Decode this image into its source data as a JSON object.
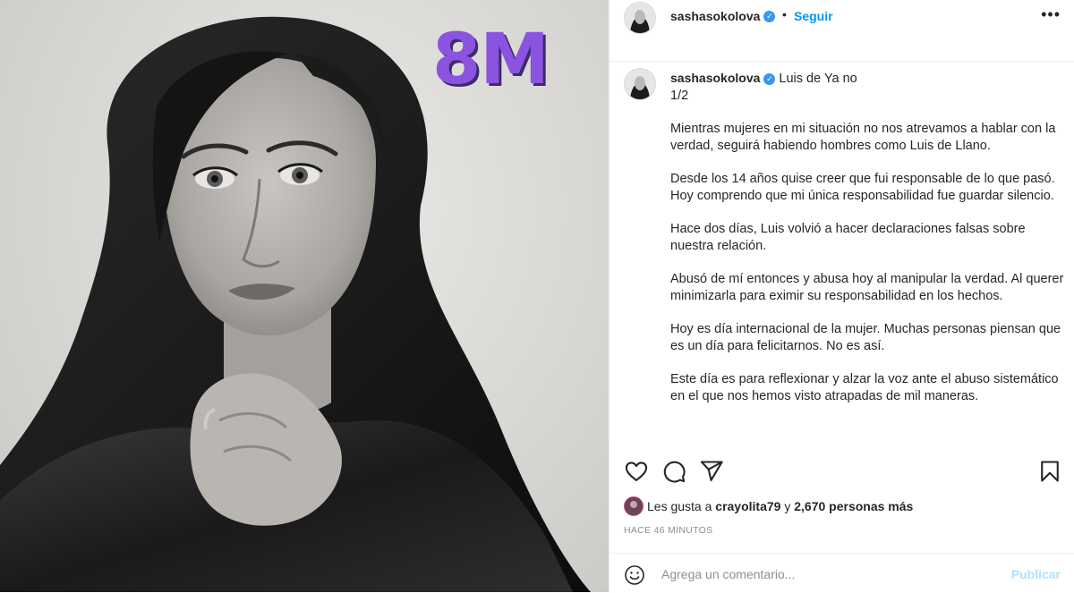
{
  "post_image": {
    "overlay_text": "8M",
    "overlay_color": "#8a54e0"
  },
  "header": {
    "username": "sashasokolova",
    "separator": "•",
    "follow_label": "Seguir",
    "more_icon": "more-horizontal-icon"
  },
  "caption": {
    "username": "sashasokolova",
    "title": "Luis de Ya no",
    "paragraphs": [
      "1/2",
      "Mientras mujeres en mi situación no nos atrevamos a hablar con la verdad, seguirá habiendo hombres como Luis de Llano.",
      "Desde los 14 años quise creer que fui responsable de lo que pasó. Hoy comprendo que mi única responsabilidad fue guardar silencio.",
      "Hace dos días, Luis volvió a hacer declaraciones falsas sobre nuestra relación.",
      "Abusó de mí entonces y abusa hoy al manipular la verdad. Al querer minimizarla para eximir su responsabilidad en los hechos.",
      "Hoy es día internacional de la mujer. Muchas personas piensan que es un día para felicitarnos. No es así.",
      "Este día es para reflexionar y alzar la voz ante el abuso sistemático en el que nos hemos visto atrapadas de mil maneras."
    ]
  },
  "actions": {
    "like_icon": "heart-icon",
    "comment_icon": "comment-bubble-icon",
    "share_icon": "paper-plane-icon",
    "save_icon": "bookmark-icon"
  },
  "likes": {
    "prefix": "Les gusta a ",
    "user": "crayolita79",
    "middle": " y ",
    "others": "2,670 personas más"
  },
  "timestamp": "HACE 46 MINUTOS",
  "comment_box": {
    "placeholder": "Agrega un comentario...",
    "publish_label": "Publicar",
    "emoji_icon": "smiley-icon"
  },
  "colors": {
    "accent": "#0095f6",
    "publish_disabled": "#b2dffc",
    "verified": "#3897f0"
  }
}
